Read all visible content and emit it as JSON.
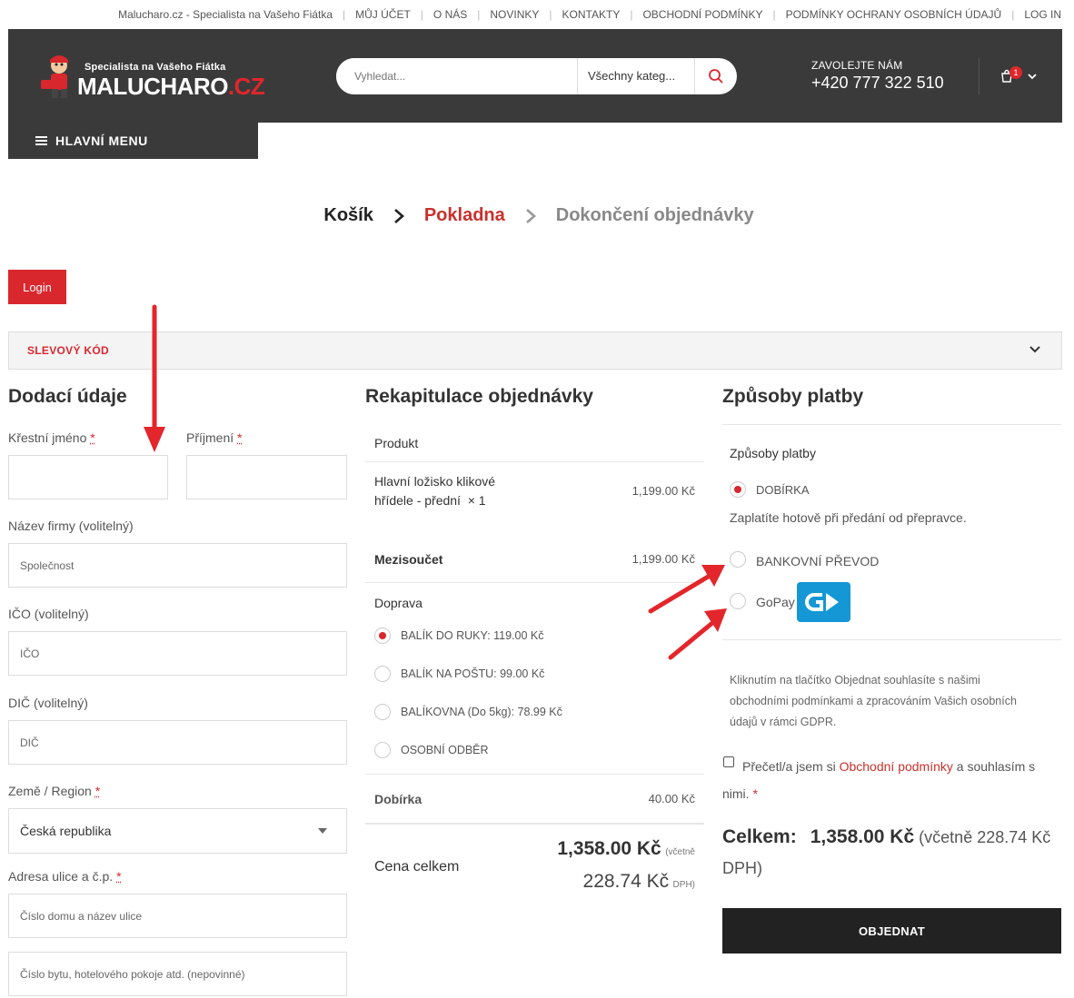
{
  "topbar": {
    "links": [
      "Malucharo.cz - Specialista na Vašeho Fiátka",
      "MŮJ ÚČET",
      "O NÁS",
      "NOVINKY",
      "KONTAKTY",
      "OBCHODNÍ PODMÍNKY",
      "PODMÍNKY OCHRANY OSOBNÍCH ÚDAJŮ",
      "LOG IN"
    ]
  },
  "header": {
    "logo_tagline": "Specialista na Vašeho Fiátka",
    "logo_brand": "MALUCHARO",
    "logo_tld": ".CZ",
    "search_placeholder": "Vyhledat...",
    "search_category": "Všechny kateg...",
    "phone_label": "ZAVOLEJTE NÁM",
    "phone_number": "+420 777 322 510",
    "cart_count": "1",
    "menu_label": "HLAVNÍ MENU"
  },
  "steps": {
    "cart": "Košík",
    "checkout": "Pokladna",
    "done": "Dokončení objednávky"
  },
  "login_label": "Login",
  "coupon_label": "SLEVOVÝ KÓD",
  "billing": {
    "title": "Dodací údaje",
    "first_name_label": "Křestní jméno",
    "last_name_label": "Příjmení",
    "required_mark": "*",
    "company_label": "Název firmy (volitelný)",
    "company_placeholder": "Společnost",
    "ico_label": "IČO (volitelný)",
    "ico_placeholder": "IČO",
    "dic_label": "DIČ (volitelný)",
    "dic_placeholder": "DIČ",
    "country_label": "Země / Region",
    "country_value": "Česká republika",
    "address_label": "Adresa ulice a č.p.",
    "address_placeholder": "Číslo domu a název ulice",
    "address2_placeholder": "Číslo bytu, hotelového pokoje atd. (nepovinné)"
  },
  "summary": {
    "title": "Rekapitulace objednávky",
    "product_header": "Produkt",
    "product_name_line1": "Hlavní ložisko klikové",
    "product_name_line2": "hřídele - přední",
    "product_qty": "× 1",
    "product_price": "1,199.00 Kč",
    "subtotal_label": "Mezisoučet",
    "subtotal_value": "1,199.00 Kč",
    "shipping_label": "Doprava",
    "shipping_options": [
      "BALÍK DO RUKY: 119.00 Kč",
      "BALÍK NA POŠTU: 99.00 Kč",
      "BALÍKOVNA (Do 5kg): 78.99 Kč",
      "OSOBNÍ ODBĚR"
    ],
    "selected_shipping_index": 0,
    "cod_label": "Dobírka",
    "cod_value": "40.00 Kč",
    "total_label": "Cena celkem",
    "total_value": "1,358.00 Kč",
    "total_incl": "(včetně",
    "tax_value": "228.74 Kč",
    "tax_label": "DPH)"
  },
  "payment": {
    "title": "Způsoby platby",
    "subtitle": "Způsoby platby",
    "methods": [
      "DOBÍRKA",
      "BANKOVNÍ PŘEVOD",
      "GoPay"
    ],
    "selected_index": 0,
    "cod_note": "Zaplatíte hotově při předání od přepravce.",
    "terms_text": [
      "Kliknutím na tlačítko Objednat souhlasíte s našimi",
      "obchodními podmínkami a zpracováním Vašich osobních",
      "údajů v rámci GDPR."
    ],
    "agree_prefix": "Přečetl/a jsem si",
    "agree_link": "Obchodní podmínky",
    "agree_suffix1": "a souhlasím s",
    "agree_suffix2": "nimi.",
    "required_mark": "*",
    "total_label": "Celkem:",
    "total_value": "1,358.00 Kč",
    "total_tax_line1": "(včetně 228.74 Kč",
    "total_tax_line2": "DPH)",
    "order_button": "OBJEDNAT"
  },
  "colors": {
    "accent": "#d9272e",
    "header_bg": "#3a3a3a",
    "gopay": "#1497d4",
    "annotation": "#e3262b"
  }
}
